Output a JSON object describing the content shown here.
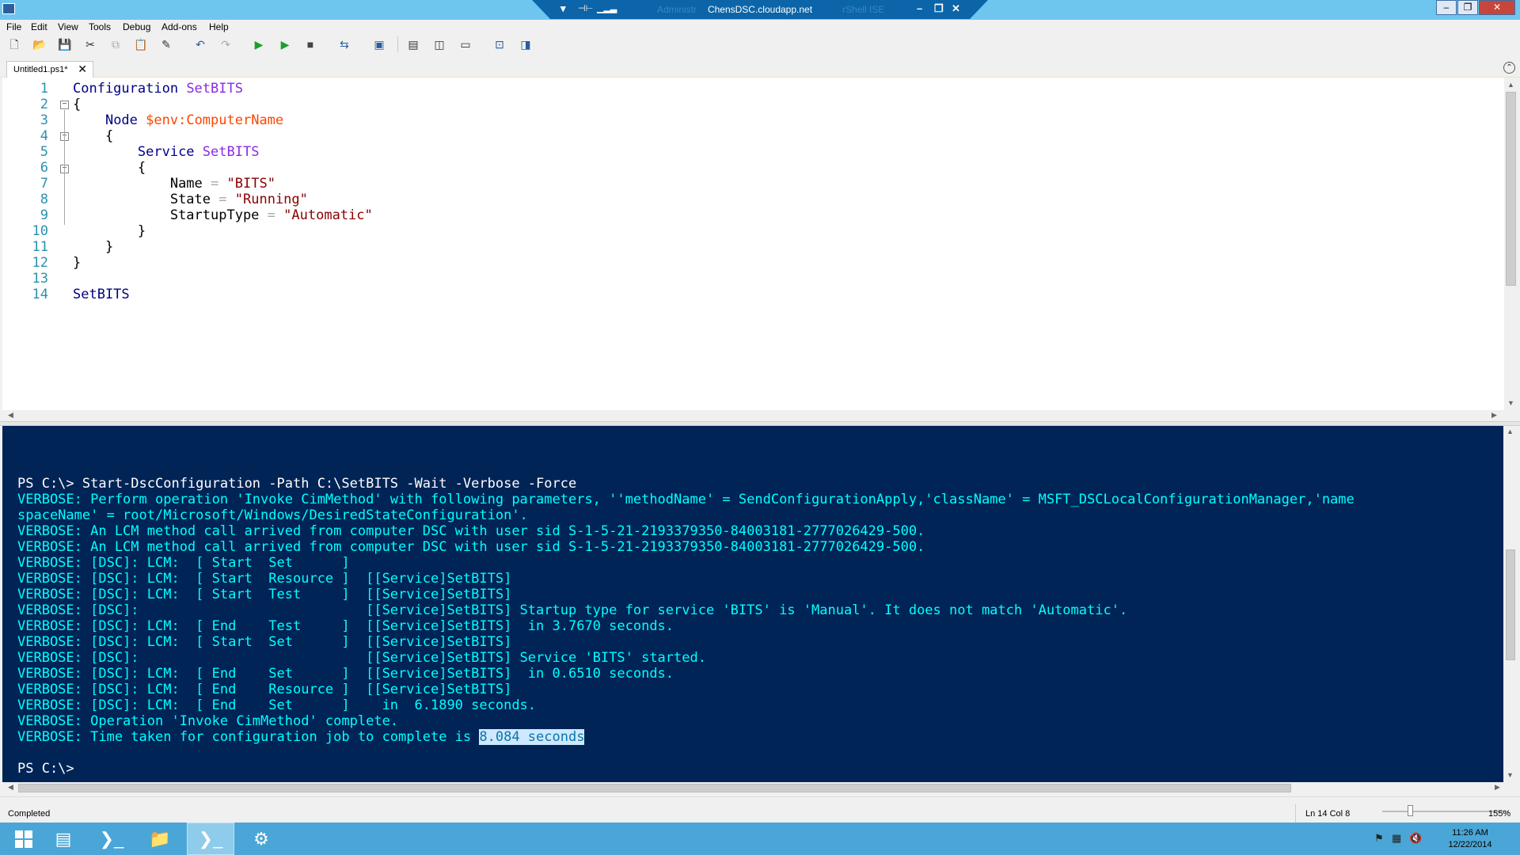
{
  "window": {
    "rdp_title": "ChensDSC.cloudapp.net",
    "ghost_left": "Administr",
    "ghost_right": "rShell ISE"
  },
  "menu": [
    "File",
    "Edit",
    "View",
    "Tools",
    "Debug",
    "Add-ons",
    "Help"
  ],
  "tab": {
    "label": "Untitled1.ps1*",
    "close": "✕"
  },
  "editor": {
    "lines": [
      {
        "n": "1"
      },
      {
        "n": "2"
      },
      {
        "n": "3"
      },
      {
        "n": "4"
      },
      {
        "n": "5"
      },
      {
        "n": "6"
      },
      {
        "n": "7"
      },
      {
        "n": "8"
      },
      {
        "n": "9"
      },
      {
        "n": "10"
      },
      {
        "n": "11"
      },
      {
        "n": "12"
      },
      {
        "n": "13"
      },
      {
        "n": "14"
      }
    ],
    "tokens": {
      "l1_kw": "Configuration",
      "l1_name": "SetBITS",
      "l2": "{",
      "l3_kw": "Node",
      "l3_var": "$env:ComputerName",
      "l4": "{",
      "l5_kw": "Service",
      "l5_name": "SetBITS",
      "l6": "{",
      "l7_prop": "Name",
      "l7_eq": "=",
      "l7_val": "\"BITS\"",
      "l8_prop": "State",
      "l8_eq": "=",
      "l8_val": "\"Running\"",
      "l9_prop": "StartupType",
      "l9_eq": "=",
      "l9_val": "\"Automatic\"",
      "l10": "}",
      "l11": "}",
      "l12": "}",
      "l14": "SetBITS"
    }
  },
  "console": {
    "command": "PS C:\\> Start-DscConfiguration -Path C:\\SetBITS -Wait -Verbose -Force",
    "verbose": [
      "VERBOSE: Perform operation 'Invoke CimMethod' with following parameters, ''methodName' = SendConfigurationApply,'className' = MSFT_DSCLocalConfigurationManager,'name",
      "spaceName' = root/Microsoft/Windows/DesiredStateConfiguration'.",
      "VERBOSE: An LCM method call arrived from computer DSC with user sid S-1-5-21-2193379350-84003181-2777026429-500.",
      "VERBOSE: An LCM method call arrived from computer DSC with user sid S-1-5-21-2193379350-84003181-2777026429-500.",
      "VERBOSE: [DSC]: LCM:  [ Start  Set      ]",
      "VERBOSE: [DSC]: LCM:  [ Start  Resource ]  [[Service]SetBITS]",
      "VERBOSE: [DSC]: LCM:  [ Start  Test     ]  [[Service]SetBITS]",
      "VERBOSE: [DSC]:                            [[Service]SetBITS] Startup type for service 'BITS' is 'Manual'. It does not match 'Automatic'.",
      "VERBOSE: [DSC]: LCM:  [ End    Test     ]  [[Service]SetBITS]  in 3.7670 seconds.",
      "VERBOSE: [DSC]: LCM:  [ Start  Set      ]  [[Service]SetBITS]",
      "VERBOSE: [DSC]:                            [[Service]SetBITS] Service 'BITS' started.",
      "VERBOSE: [DSC]: LCM:  [ End    Set      ]  [[Service]SetBITS]  in 0.6510 seconds.",
      "VERBOSE: [DSC]: LCM:  [ End    Resource ]  [[Service]SetBITS]",
      "VERBOSE: [DSC]: LCM:  [ End    Set      ]    in  6.1890 seconds.",
      "VERBOSE: Operation 'Invoke CimMethod' complete."
    ],
    "last_prefix": "VERBOSE: Time taken for configuration job to complete is ",
    "last_highlight": "8.084 seconds",
    "prompt": "PS C:\\>"
  },
  "status": {
    "text": "Completed",
    "position": "Ln 14  Col 8",
    "zoom": "155%",
    "zoom_level_percent": 155
  },
  "taskbar": {
    "time": "11:26 AM",
    "date": "12/22/2014"
  }
}
